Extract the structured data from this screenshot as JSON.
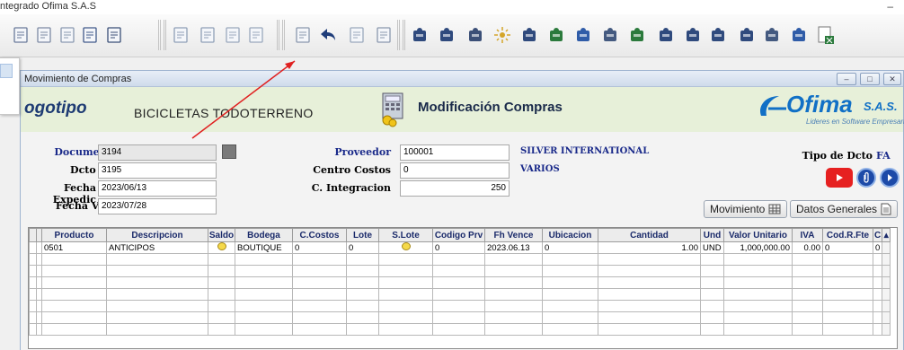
{
  "app": {
    "title": "ntegrado Ofima S.A.S",
    "minimize": "–"
  },
  "toolbar": {
    "items": [
      "new-doc-icon",
      "copy-doc-icon",
      "window-icon",
      "home-icon",
      "truck-icon",
      "doc-plus-icon",
      "edit-doc-icon",
      "doc-lines-icon",
      "doc-lines-alt-icon",
      "save-icon",
      "back-arrow-icon",
      "doc-list-icon",
      "export-icon",
      "people-icon",
      "group-icon",
      "building-icon",
      "sparkle-icon",
      "person-icon",
      "truck-green-icon",
      "swap-icon",
      "diamond-icon",
      "money-icon",
      "user-upload-icon",
      "factory-icon",
      "document-icon",
      "box-icon",
      "clipboard-icon",
      "user-add-icon",
      "excel-icon"
    ]
  },
  "window": {
    "title": "Movimiento de Compras",
    "buttons": [
      "–",
      "□",
      "✕"
    ]
  },
  "header": {
    "logo": "ogotipo",
    "company": "BICICLETAS TODOTERRENO",
    "screen_title": "Modificación Compras",
    "brand": "Ofima",
    "brand_suffix": "S.A.S.",
    "brand_tagline": "Lideres en Software Empresarial"
  },
  "form": {
    "documento_label": "Documento",
    "documento": "3194",
    "dcto_prv_label": "Dcto Prv",
    "dcto_prv": "3195",
    "fecha_expedic_label": "Fecha Expedic",
    "fecha_expedic": "2023/06/13",
    "fecha_venc_label": "Fecha Venc",
    "fecha_venc": "2023/07/28",
    "proveedor_label": "Proveedor",
    "proveedor": "100001",
    "proveedor_name": "SILVER INTERNATIONAL",
    "centro_costos_label": "Centro Costos",
    "centro_costos": "0",
    "centro_costos_name": "VARIOS",
    "c_integracion_label": "C. Integracion",
    "c_integracion": "250",
    "tipo_dcto_label": "Tipo de Dcto",
    "tipo_dcto": "FA",
    "movimiento_btn": "Movimiento",
    "datos_generales_btn": "Datos Generales"
  },
  "grid": {
    "columns": [
      "Producto",
      "Descripcion",
      "Saldo",
      "Bodega",
      "C.Costos",
      "Lote",
      "S.Lote",
      "Codigo Prv",
      "Fh Vence",
      "Ubicacion",
      "Cantidad",
      "Und",
      "Valor Unitario",
      "IVA",
      "Cod.R.Fte",
      "C"
    ],
    "rows": [
      [
        "0501",
        "ANTICIPOS",
        "",
        "BOUTIQUE",
        "0",
        "0",
        "",
        "0",
        "2023.06.13",
        "0",
        "1.00",
        "UND",
        "1,000,000.00",
        "0.00",
        "0",
        "0"
      ]
    ]
  },
  "colors": {
    "band": "#e7f0d9",
    "label_blue": "#1a2a8a",
    "brand_blue": "#1170c6",
    "arrow_red": "#e02020"
  }
}
